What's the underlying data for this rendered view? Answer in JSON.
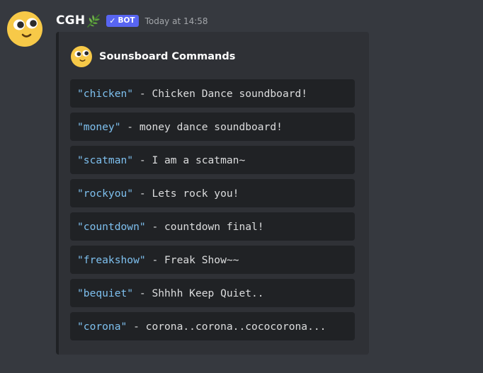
{
  "message": {
    "username": "CGH",
    "bot_tag": "BOT",
    "bot_check": "✓",
    "timestamp": "Today at 14:58",
    "avatar_icon": "smiley-face-avatar-icon",
    "username_badge_icon": "leaf-icon"
  },
  "embed": {
    "author_name": "Sounsboard Commands",
    "author_icon": "smiley-face-icon",
    "commands": [
      {
        "name": "\"chicken\"",
        "separator": " - ",
        "description": "Chicken Dance soundboard!"
      },
      {
        "name": "\"money\"",
        "separator": " - ",
        "description": "money dance soundboard!"
      },
      {
        "name": "\"scatman\"",
        "separator": " - ",
        "description": "I am a scatman~"
      },
      {
        "name": "\"rockyou\"",
        "separator": " - ",
        "description": "Lets rock you!"
      },
      {
        "name": "\"countdown\"",
        "separator": " - ",
        "description": "countdown final!"
      },
      {
        "name": "\"freakshow\"",
        "separator": " - ",
        "description": "Freak Show~~"
      },
      {
        "name": "\"bequiet\"",
        "separator": " - ",
        "description": "Shhhh Keep Quiet.."
      },
      {
        "name": "\"corona\"",
        "separator": " - ",
        "description": "corona..corona..cococorona..."
      }
    ]
  },
  "colors": {
    "background": "#36393f",
    "embed_background": "#2f3136",
    "embed_border": "#202225",
    "code_background": "#202225",
    "command_name": "#7ec0ef",
    "text": "#dcddde",
    "bot_tag": "#5865f2",
    "timestamp": "#a3a6aa",
    "avatar_face": "#f7c948"
  }
}
